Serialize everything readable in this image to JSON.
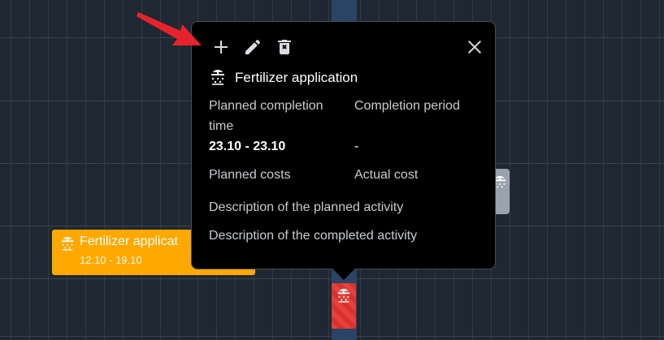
{
  "popup": {
    "title": "Fertilizer application",
    "planned_completion_label": "Planned completion time",
    "planned_completion_value": "23.10 - 23.10",
    "completion_period_label": "Completion period",
    "completion_period_value": "-",
    "planned_costs_label": "Planned costs",
    "actual_cost_label": "Actual cost",
    "planned_description_label": "Description of the planned activity",
    "completed_description_label": "Description of the completed activity",
    "actions": [
      "add-icon",
      "edit-icon",
      "delete-icon",
      "close-icon"
    ]
  },
  "timeline_tasks": [
    {
      "title": "Fertilizer applicat",
      "dates": "12.10 - 19.10",
      "color": "#ffa800",
      "icon": "fertilizer-icon"
    },
    {
      "title": "",
      "dates": "",
      "color": "#9aa3ad",
      "icon": "fertilizer-icon"
    },
    {
      "title": "",
      "dates": "",
      "color": "#e8403b",
      "icon": "fertilizer-icon"
    }
  ],
  "colors": {
    "background": "#1f2832",
    "today_column": "#2b4466",
    "popup_background": "#000000",
    "annotation_arrow": "#e8222a"
  }
}
